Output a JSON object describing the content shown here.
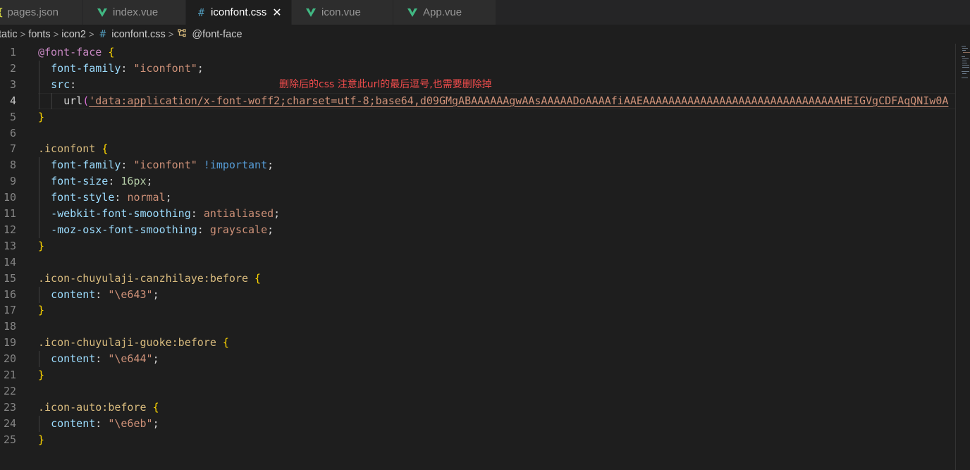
{
  "tabs": [
    {
      "label": "pages.json",
      "icon": "json-icon",
      "active": false
    },
    {
      "label": "index.vue",
      "icon": "vue-icon",
      "active": false
    },
    {
      "label": "iconfont.css",
      "icon": "css-icon",
      "active": true
    },
    {
      "label": "icon.vue",
      "icon": "vue-icon",
      "active": false
    },
    {
      "label": "App.vue",
      "icon": "vue-icon",
      "active": false
    }
  ],
  "breadcrumb": {
    "items": [
      "tatic",
      "fonts",
      "icon2"
    ],
    "file": "iconfont.css",
    "symbol": "@font-face"
  },
  "annotation": "删除后的css    注意此url的最后逗号,也需要删除掉",
  "editor": {
    "current_line": 4,
    "lines": [
      {
        "n": "1",
        "tokens": [
          [
            "t-at",
            "@font-face"
          ],
          [
            "t-punc",
            " "
          ],
          [
            "t-brace",
            "{"
          ]
        ]
      },
      {
        "n": "2",
        "tokens": [
          [
            "t-punc",
            "  "
          ],
          [
            "t-prop",
            "font-family"
          ],
          [
            "t-punc",
            ": "
          ],
          [
            "t-str",
            "\"iconfont\""
          ],
          [
            "t-punc",
            ";"
          ]
        ]
      },
      {
        "n": "3",
        "tokens": [
          [
            "t-punc",
            "  "
          ],
          [
            "t-prop",
            "src"
          ],
          [
            "t-punc",
            ":"
          ]
        ]
      },
      {
        "n": "4",
        "tokens": [
          [
            "t-punc",
            "    "
          ],
          [
            "t-fn",
            "url"
          ],
          [
            "t-paren",
            "("
          ],
          [
            "url-str",
            "'data:application/x-font-woff2;charset=utf-8;base64,d09GMgABAAAAAAgwAAsAAAAADoAAAAfiAAEAAAAAAAAAAAAAAAAAAAAAAAAAAAAAAAHEIGVgCDFAqQNIw0A"
          ]
        ]
      },
      {
        "n": "5",
        "tokens": [
          [
            "t-brace",
            "}"
          ]
        ]
      },
      {
        "n": "6",
        "tokens": []
      },
      {
        "n": "7",
        "tokens": [
          [
            "t-sel",
            ".iconfont"
          ],
          [
            "t-punc",
            " "
          ],
          [
            "t-brace",
            "{"
          ]
        ]
      },
      {
        "n": "8",
        "tokens": [
          [
            "t-punc",
            "  "
          ],
          [
            "t-prop",
            "font-family"
          ],
          [
            "t-punc",
            ": "
          ],
          [
            "t-str",
            "\"iconfont\""
          ],
          [
            "t-punc",
            " "
          ],
          [
            "t-kw",
            "!important"
          ],
          [
            "t-punc",
            ";"
          ]
        ]
      },
      {
        "n": "9",
        "tokens": [
          [
            "t-punc",
            "  "
          ],
          [
            "t-prop",
            "font-size"
          ],
          [
            "t-punc",
            ": "
          ],
          [
            "t-num",
            "16px"
          ],
          [
            "t-punc",
            ";"
          ]
        ]
      },
      {
        "n": "10",
        "tokens": [
          [
            "t-punc",
            "  "
          ],
          [
            "t-prop",
            "font-style"
          ],
          [
            "t-punc",
            ": "
          ],
          [
            "t-str",
            "normal"
          ],
          [
            "t-punc",
            ";"
          ]
        ]
      },
      {
        "n": "11",
        "tokens": [
          [
            "t-punc",
            "  "
          ],
          [
            "t-prop",
            "-webkit-font-smoothing"
          ],
          [
            "t-punc",
            ": "
          ],
          [
            "t-str",
            "antialiased"
          ],
          [
            "t-punc",
            ";"
          ]
        ]
      },
      {
        "n": "12",
        "tokens": [
          [
            "t-punc",
            "  "
          ],
          [
            "t-prop",
            "-moz-osx-font-smoothing"
          ],
          [
            "t-punc",
            ": "
          ],
          [
            "t-str",
            "grayscale"
          ],
          [
            "t-punc",
            ";"
          ]
        ]
      },
      {
        "n": "13",
        "tokens": [
          [
            "t-brace",
            "}"
          ]
        ]
      },
      {
        "n": "14",
        "tokens": []
      },
      {
        "n": "15",
        "tokens": [
          [
            "t-sel",
            ".icon-chuyulaji-canzhilaye:before"
          ],
          [
            "t-punc",
            " "
          ],
          [
            "t-brace",
            "{"
          ]
        ]
      },
      {
        "n": "16",
        "tokens": [
          [
            "t-punc",
            "  "
          ],
          [
            "t-prop",
            "content"
          ],
          [
            "t-punc",
            ": "
          ],
          [
            "t-str",
            "\"\\e643\""
          ],
          [
            "t-punc",
            ";"
          ]
        ]
      },
      {
        "n": "17",
        "tokens": [
          [
            "t-brace",
            "}"
          ]
        ]
      },
      {
        "n": "18",
        "tokens": []
      },
      {
        "n": "19",
        "tokens": [
          [
            "t-sel",
            ".icon-chuyulaji-guoke:before"
          ],
          [
            "t-punc",
            " "
          ],
          [
            "t-brace",
            "{"
          ]
        ]
      },
      {
        "n": "20",
        "tokens": [
          [
            "t-punc",
            "  "
          ],
          [
            "t-prop",
            "content"
          ],
          [
            "t-punc",
            ": "
          ],
          [
            "t-str",
            "\"\\e644\""
          ],
          [
            "t-punc",
            ";"
          ]
        ]
      },
      {
        "n": "21",
        "tokens": [
          [
            "t-brace",
            "}"
          ]
        ]
      },
      {
        "n": "22",
        "tokens": []
      },
      {
        "n": "23",
        "tokens": [
          [
            "t-sel",
            ".icon-auto:before"
          ],
          [
            "t-punc",
            " "
          ],
          [
            "t-brace",
            "{"
          ]
        ]
      },
      {
        "n": "24",
        "tokens": [
          [
            "t-punc",
            "  "
          ],
          [
            "t-prop",
            "content"
          ],
          [
            "t-punc",
            ": "
          ],
          [
            "t-str",
            "\"\\e6eb\""
          ],
          [
            "t-punc",
            ";"
          ]
        ]
      },
      {
        "n": "25",
        "tokens": [
          [
            "t-brace",
            "}"
          ]
        ]
      }
    ]
  }
}
